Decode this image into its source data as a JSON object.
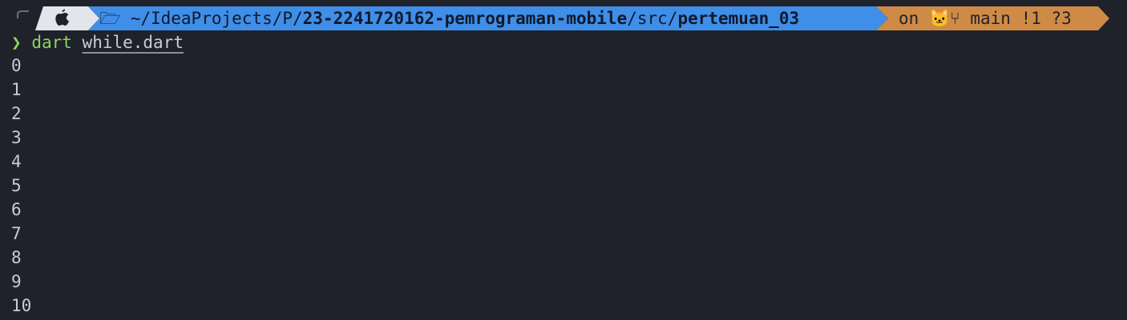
{
  "prompt": {
    "os_icon": "apple-icon",
    "folder_icon": "folder-icon",
    "path_prefix": "~/IdeaProjects/P/",
    "path_repo": "23-2241720162-pemrograman-mobile",
    "path_mid": "/src/",
    "path_leaf": "pertemuan_03",
    "git_on": "on",
    "github_icon": "github-icon",
    "branch_icon": "git-branch-icon",
    "git_branch": "main",
    "git_status": "!1 ?3",
    "colors": {
      "os_segment": "#e3e5ea",
      "path_segment": "#3f8ee8",
      "git_segment": "#cf8a45",
      "background": "#1f222b"
    }
  },
  "command": {
    "caret": "❯",
    "program": "dart",
    "argument": "while.dart"
  },
  "output_lines": [
    "0",
    "1",
    "2",
    "3",
    "4",
    "5",
    "6",
    "7",
    "8",
    "9",
    "10"
  ]
}
